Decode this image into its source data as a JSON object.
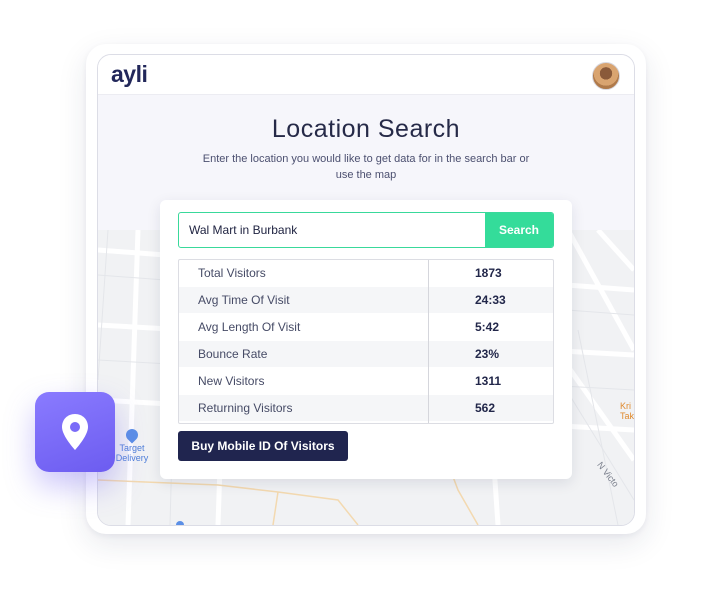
{
  "app": {
    "logo": "ayli"
  },
  "hero": {
    "title": "Location Search",
    "subtitle": "Enter the location you would like to get data for in the search bar or use the map"
  },
  "search": {
    "value": "Wal Mart in Burbank",
    "button_label": "Search"
  },
  "stats": [
    {
      "label": "Total Visitors",
      "value": "1873"
    },
    {
      "label": "Avg Time Of Visit",
      "value": "24:33"
    },
    {
      "label": "Avg Length Of Visit",
      "value": "5:42"
    },
    {
      "label": "Bounce Rate",
      "value": "23%"
    },
    {
      "label": "New Visitors",
      "value": "1311"
    },
    {
      "label": "Returning Visitors",
      "value": "562"
    }
  ],
  "actions": {
    "buy_label": "Buy Mobile ID Of Visitors"
  },
  "map": {
    "poi_target_name": "Target",
    "poi_target_sub": "Delivery",
    "poi_kri_line1": "Kri",
    "poi_kri_line2": "Take",
    "street_label": "N Victo"
  },
  "colors": {
    "accent_green": "#34dc9a",
    "navy": "#20254f",
    "badge_purple": "#7b6cf6"
  },
  "icons": {
    "avatar": "user-avatar",
    "badge": "location-pin-icon"
  }
}
